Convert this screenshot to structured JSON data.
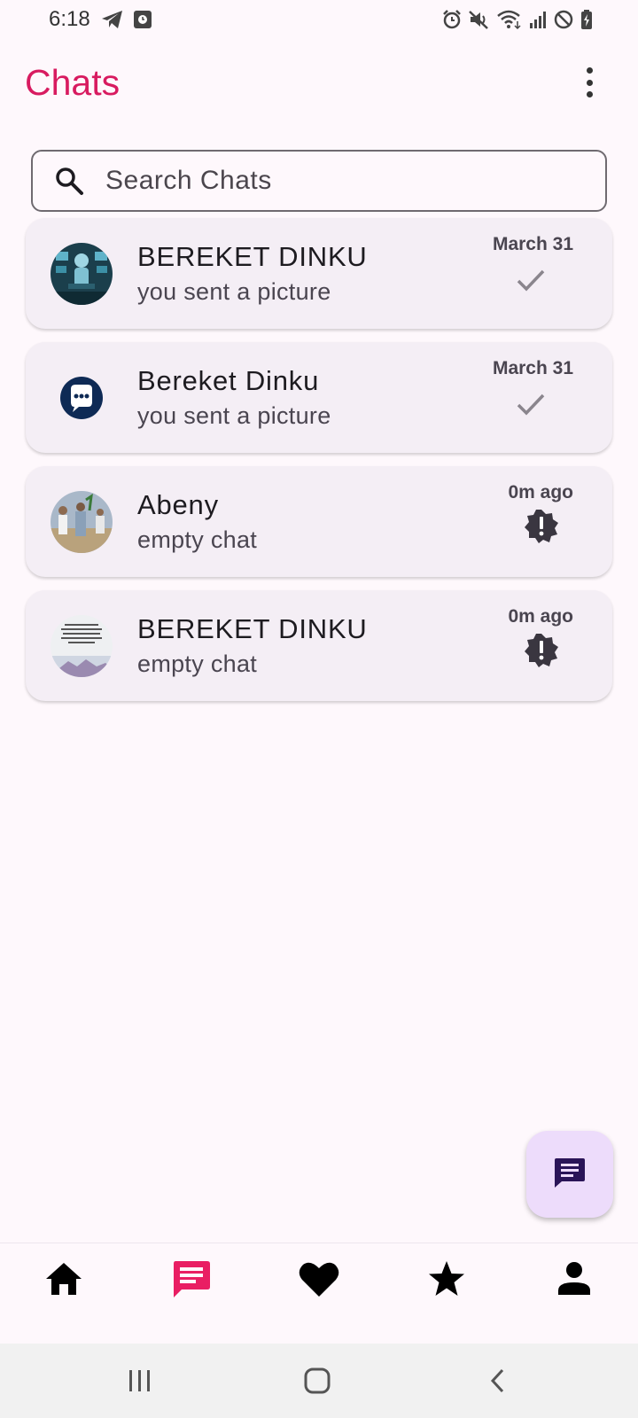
{
  "status_bar": {
    "time": "6:18",
    "left_icons": [
      "telegram-icon",
      "clock-app-icon"
    ],
    "right_icons": [
      "alarm-icon",
      "mute-icon",
      "wifi-icon",
      "signal-icon",
      "dnd-icon",
      "battery-charging-icon"
    ]
  },
  "header": {
    "title": "Chats",
    "menu_icon": "more-vert-icon"
  },
  "search": {
    "placeholder": "Search Chats",
    "icon": "search-icon"
  },
  "chats": [
    {
      "name": "BEREKET DINKU",
      "preview": "you sent a picture",
      "time": "March 31",
      "status_icon": "check-icon",
      "avatar": "ai-robot-photo"
    },
    {
      "name": "Bereket Dinku",
      "preview": "you sent a picture",
      "time": "March 31",
      "status_icon": "check-icon",
      "avatar": "chat-bubble-logo"
    },
    {
      "name": "Abeny",
      "preview": "empty chat",
      "time": "0m ago",
      "status_icon": "new-badge-icon",
      "avatar": "group-photo"
    },
    {
      "name": "BEREKET DINKU",
      "preview": "empty chat",
      "time": "0m ago",
      "status_icon": "new-badge-icon",
      "avatar": "text-quote-photo"
    }
  ],
  "fab": {
    "icon": "message-icon"
  },
  "bottom_nav": {
    "items": [
      {
        "icon": "home-icon",
        "active": false
      },
      {
        "icon": "chat-icon",
        "active": true
      },
      {
        "icon": "heart-icon",
        "active": false
      },
      {
        "icon": "star-icon",
        "active": false
      },
      {
        "icon": "person-icon",
        "active": false
      }
    ]
  },
  "system_nav": [
    "recents-button",
    "home-button",
    "back-button"
  ],
  "colors": {
    "accent": "#d81b60",
    "background": "#fef8fc",
    "card": "#f4eef5",
    "fab": "#eddcfb",
    "fab_icon": "#2a1458"
  }
}
